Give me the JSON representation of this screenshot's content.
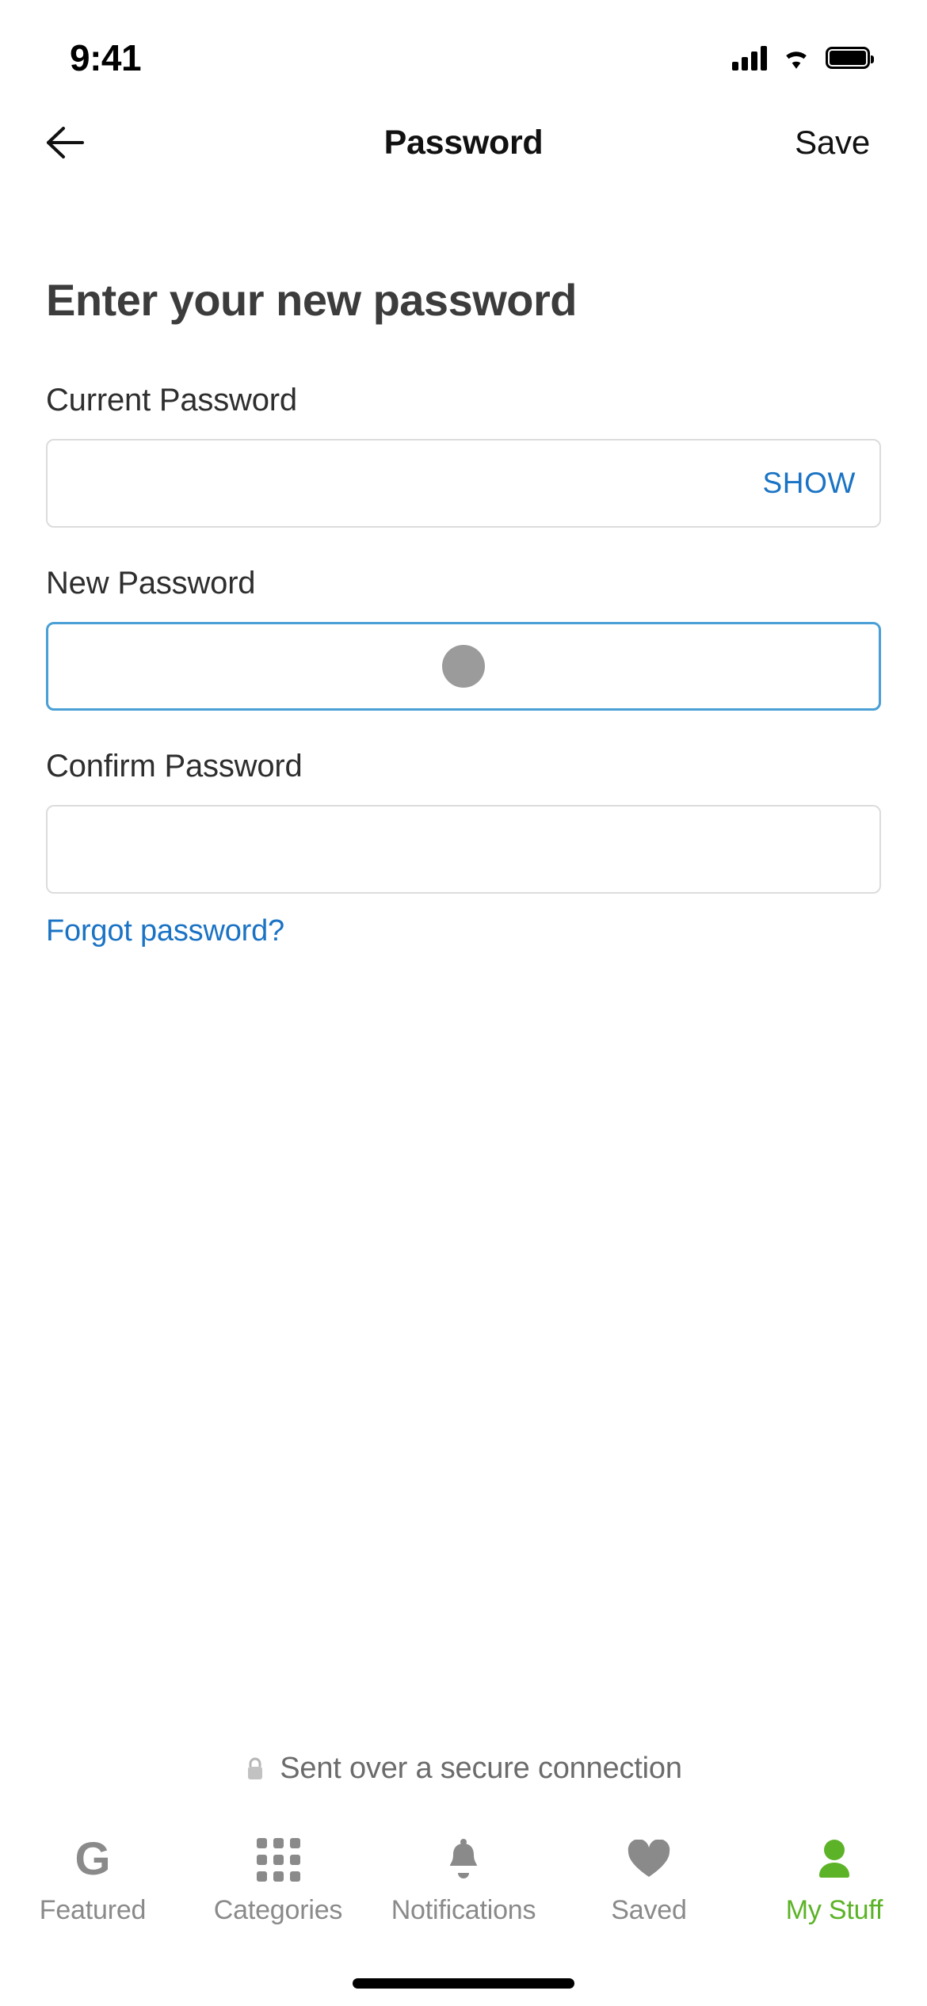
{
  "status_bar": {
    "time": "9:41",
    "signal_icon": "cellular-signal-icon",
    "wifi_icon": "wifi-icon",
    "battery_icon": "battery-full-icon"
  },
  "navbar": {
    "back_icon": "back-arrow-icon",
    "title": "Password",
    "save_label": "Save"
  },
  "main": {
    "heading": "Enter your new password",
    "fields": [
      {
        "label": "Current Password",
        "value": "",
        "placeholder": "",
        "action_label": "SHOW",
        "focused": false,
        "masked_char_shown": false
      },
      {
        "label": "New Password",
        "value": "",
        "placeholder": "",
        "action_label": "",
        "focused": true,
        "masked_char_shown": true
      },
      {
        "label": "Confirm Password",
        "value": "",
        "placeholder": "",
        "action_label": "",
        "focused": false,
        "masked_char_shown": false
      }
    ],
    "forgot_link": "Forgot password?"
  },
  "secure_note": {
    "lock_icon": "lock-icon",
    "text": "Sent over a secure connection"
  },
  "tabbar": {
    "items": [
      {
        "label": "Featured",
        "icon": "g-logo-icon",
        "active": false
      },
      {
        "label": "Categories",
        "icon": "grid-icon",
        "active": false
      },
      {
        "label": "Notifications",
        "icon": "bell-icon",
        "active": false
      },
      {
        "label": "Saved",
        "icon": "heart-icon",
        "active": false
      },
      {
        "label": "My Stuff",
        "icon": "person-icon",
        "active": true
      }
    ]
  },
  "colors": {
    "accent_blue": "#1a73c4",
    "focus_blue": "#4a9fd5",
    "active_green": "#5cb327",
    "inactive_gray": "#8a8a8a",
    "border_gray": "#dcdcdc",
    "dot_gray": "#9b9b9b"
  }
}
